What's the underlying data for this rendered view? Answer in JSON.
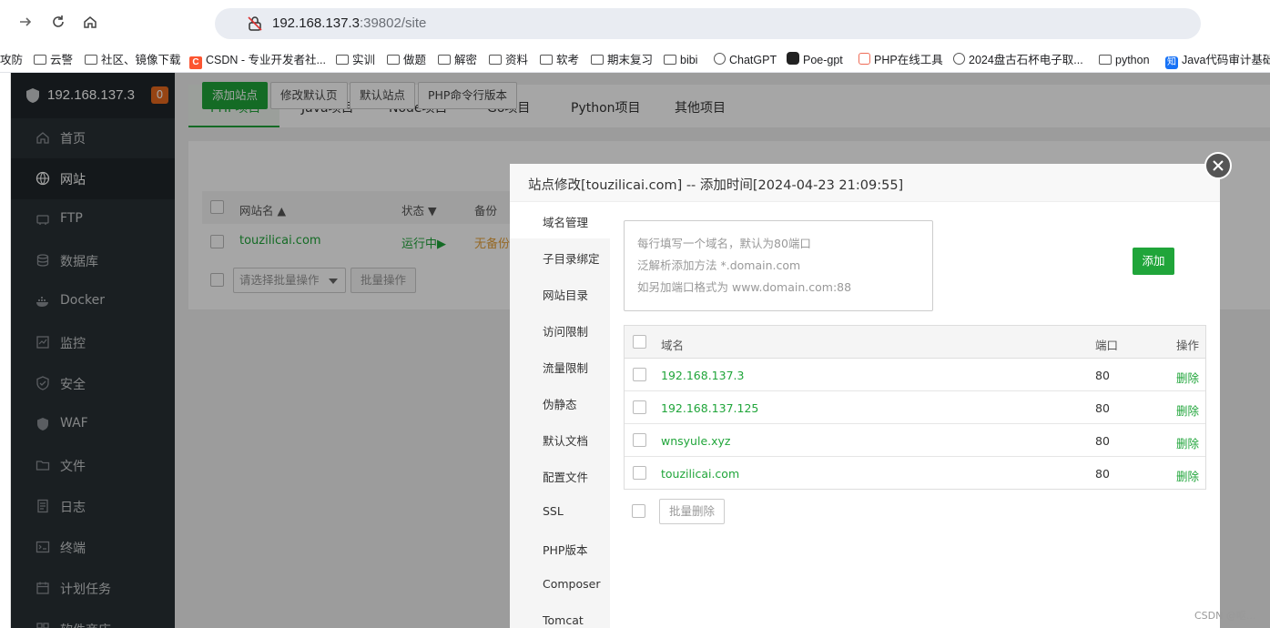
{
  "browser": {
    "url_host": "192.168.137.3",
    "url_rest": ":39802/site",
    "bookmarks": [
      {
        "label": "攻防",
        "icon": "none"
      },
      {
        "label": "云警",
        "icon": "folder-icon"
      },
      {
        "label": "社区、镜像下载",
        "icon": "folder-icon"
      },
      {
        "label": "CSDN - 专业开发者社...",
        "icon": "csdn-icon"
      },
      {
        "label": "实训",
        "icon": "folder-icon"
      },
      {
        "label": "做题",
        "icon": "folder-icon"
      },
      {
        "label": "解密",
        "icon": "folder-icon"
      },
      {
        "label": "资料",
        "icon": "folder-icon"
      },
      {
        "label": "软考",
        "icon": "folder-icon"
      },
      {
        "label": "期末复习",
        "icon": "folder-icon"
      },
      {
        "label": "bibi",
        "icon": "folder-icon"
      },
      {
        "label": "ChatGPT",
        "icon": "chatgpt-icon"
      },
      {
        "label": "Poe-gpt",
        "icon": "poe-icon"
      },
      {
        "label": "PHP在线工具",
        "icon": "php-icon"
      },
      {
        "label": "2024盘古石杯电子取...",
        "icon": "globe-icon"
      },
      {
        "label": "python",
        "icon": "folder-icon"
      },
      {
        "label": "Java代码审计基础",
        "icon": "zhihu-icon"
      }
    ]
  },
  "sidebar": {
    "host": "192.168.137.3",
    "badge": "0",
    "items": [
      {
        "label": "首页",
        "icon": "home-icon"
      },
      {
        "label": "网站",
        "icon": "globe-icon"
      },
      {
        "label": "FTP",
        "icon": "ftp-icon"
      },
      {
        "label": "数据库",
        "icon": "database-icon"
      },
      {
        "label": "Docker",
        "icon": "docker-icon"
      },
      {
        "label": "监控",
        "icon": "monitor-icon"
      },
      {
        "label": "安全",
        "icon": "shield-check-icon"
      },
      {
        "label": "WAF",
        "icon": "waf-shield-icon"
      },
      {
        "label": "文件",
        "icon": "folder-icon"
      },
      {
        "label": "日志",
        "icon": "log-icon"
      },
      {
        "label": "终端",
        "icon": "terminal-icon"
      },
      {
        "label": "计划任务",
        "icon": "calendar-icon"
      },
      {
        "label": "软件商店",
        "icon": "apps-icon"
      }
    ]
  },
  "tabs": [
    "PHP项目",
    "Java项目",
    "Node项目",
    "Go项目",
    "Python项目",
    "其他项目"
  ],
  "toolbar": {
    "add_site": "添加站点",
    "edit_default": "修改默认页",
    "default_site": "默认站点",
    "php_cli": "PHP命令行版本"
  },
  "site_table": {
    "headers": {
      "name": "网站名",
      "status": "状态",
      "backup": "备份"
    },
    "rows": [
      {
        "name": "touzilicai.com",
        "status": "运行中▶",
        "backup": "无备份"
      }
    ],
    "batch_select_placeholder": "请选择批量操作",
    "batch_button": "批量操作"
  },
  "modal": {
    "title": "站点修改[touzilicai.com] -- 添加时间[2024-04-23 21:09:55]",
    "nav": [
      "域名管理",
      "子目录绑定",
      "网站目录",
      "访问限制",
      "流量限制",
      "伪静态",
      "默认文档",
      "配置文件",
      "SSL",
      "PHP版本",
      "Composer",
      "Tomcat"
    ],
    "placeholder_lines": [
      "每行填写一个域名，默认为80端口",
      "泛解析添加方法 *.domain.com",
      "如另加端口格式为 www.domain.com:88"
    ],
    "add_button": "添加",
    "table_headers": {
      "domain": "域名",
      "port": "端口",
      "action": "操作"
    },
    "domains": [
      {
        "domain": "192.168.137.3",
        "port": "80",
        "action": "删除"
      },
      {
        "domain": "192.168.137.125",
        "port": "80",
        "action": "删除"
      },
      {
        "domain": "wnsyule.xyz",
        "port": "80",
        "action": "删除"
      },
      {
        "domain": "touzilicai.com",
        "port": "80",
        "action": "删除"
      }
    ],
    "batch_delete": "批量删除"
  },
  "watermark": "CSDN @呕..."
}
